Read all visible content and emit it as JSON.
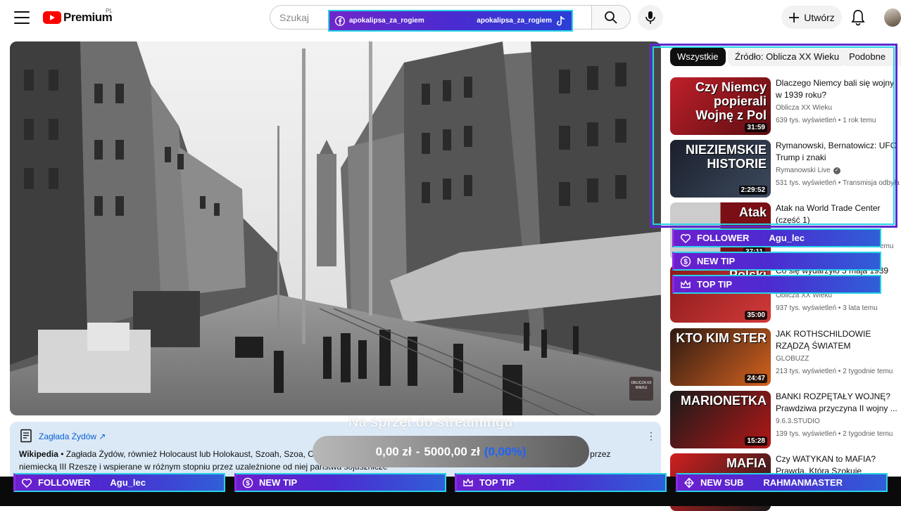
{
  "header": {
    "logo_text": "Premium",
    "logo_region": "PL",
    "search_placeholder": "Szukaj",
    "create_label": "Utwórz"
  },
  "social": {
    "left_handle": "apokalipsa_za_rogiem",
    "right_handle": "apokalipsa_za_rogiem"
  },
  "video": {
    "watermark": "OBLICZA XX WIEKU"
  },
  "wiki": {
    "title": "Zagłada Żydów",
    "source": "Wikipedia",
    "text": " • Zagłada Żydów, również Holocaust lub Holokaust, Szoah, Szoa, Churbn Ejrope – ludobójstwo Żydów dokonane w czasie II wojny światowej przez niemiecką III Rzeszę i wspierane w różnym stopniu przez uzależnione od niej państwa sojusznicze"
  },
  "donation": {
    "label": "Na sprzęt do streamingu",
    "current": "0,00 zł",
    "separator": "-",
    "goal": "5000,00 zł",
    "percent": "(0,00%)",
    "progress": 0
  },
  "sidebar": {
    "chips": [
      "Wszystkie",
      "Źródło: Oblicza XX Wieku",
      "Podobne"
    ],
    "videos": [
      {
        "title": "Dlaczego Niemcy bali się wojny",
        "title2": "w 1939 roku?",
        "channel": "Oblicza XX Wieku",
        "meta": "639 tys. wyświetleń • 1 rok temu",
        "duration": "31:59",
        "thumb_text": "Czy Niemcy popierali Wojnę z Pol"
      },
      {
        "title": "Rymanowski, Bernatowicz: UFO",
        "title2": "Trump i znaki",
        "channel": "Rymanowski Live",
        "meta": "531 tys. wyświetleń • Transmisja odbyła",
        "duration": "2:29:52",
        "thumb_text": "NIEZIEMSKIE HISTORIE"
      },
      {
        "title": "Atak na World Trade Center",
        "title2": "(część 1)",
        "channel": "",
        "meta": "",
        "duration": "",
        "thumb_text": "Atak"
      },
      {
        "title": "Co się wydarzyło 3 maja 1939",
        "title2": "",
        "channel": "Oblicza XX Wieku",
        "meta": "937 tys. wyświetleń • 3 lata temu",
        "duration": "35:00",
        "thumb_text": "Polski"
      },
      {
        "title": "JAK ROTHSCHILDOWIE",
        "title2": "RZĄDZĄ ŚWIATEM",
        "channel": "GLOBUZZ",
        "meta": "213 tys. wyświetleń • 2 tygodnie temu",
        "duration": "24:47",
        "thumb_text": "KTO KIM STER"
      },
      {
        "title": "BANKI ROZPĘTAŁY WOJNĘ?",
        "title2": "Prawdziwa przyczyna II wojny ...",
        "channel": "9.6.3.STUDIO",
        "meta": "139 tys. wyświetleń • 2 tygodnie temu",
        "duration": "15:28",
        "thumb_text": "MARIONETKA"
      },
      {
        "title": "Czy WATYKAN to MAFIA?",
        "title2": "Prawda, Która Szokuje",
        "channel": "",
        "meta": "",
        "duration": "",
        "thumb_text": "MAFIA"
      }
    ],
    "partial_duration": "37:11",
    "partial_meta_suffix": "emu"
  },
  "alerts_side": [
    {
      "label": "FOLLOWER",
      "name": "Agu_lec",
      "icon": "heart-icon"
    },
    {
      "label": "NEW TIP",
      "name": "",
      "icon": "dollar-icon"
    },
    {
      "label": "TOP TIP",
      "name": "",
      "icon": "crown-icon"
    }
  ],
  "alerts_bottom": [
    {
      "label": "FOLLOWER",
      "name": "Agu_lec",
      "icon": "heart-icon"
    },
    {
      "label": "NEW TIP",
      "name": "",
      "icon": "dollar-icon"
    },
    {
      "label": "TOP TIP",
      "name": "",
      "icon": "crown-icon"
    },
    {
      "label": "NEW SUB",
      "name": "RAHMANMASTER",
      "icon": "diamond-icon"
    }
  ],
  "colors": {
    "overlay_purple": "#6d1fcf",
    "overlay_cyan": "#27d3e6",
    "youtube_red": "#ff0000",
    "link_blue": "#065fd4"
  }
}
